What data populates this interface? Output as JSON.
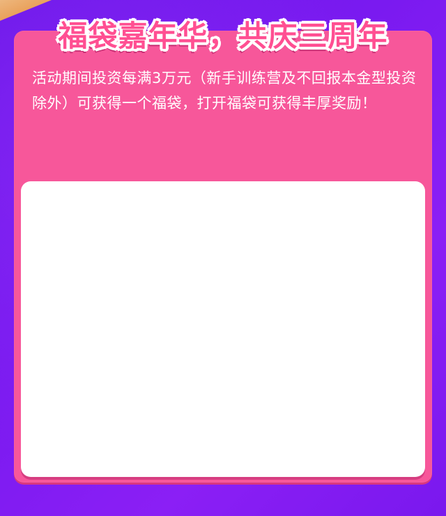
{
  "page": {
    "title": "福袋嘉年华，共庆三周年",
    "description": "活动期间投资每满3万元（新手训练营及不回报本金型投资除外）可获得一个福袋，打开福袋可获得丰厚奖励！"
  },
  "colors": {
    "background": "#7a18ee",
    "panel": "#f7579a",
    "title_fill": "#ff4f92",
    "content_box": "#ffffff"
  }
}
